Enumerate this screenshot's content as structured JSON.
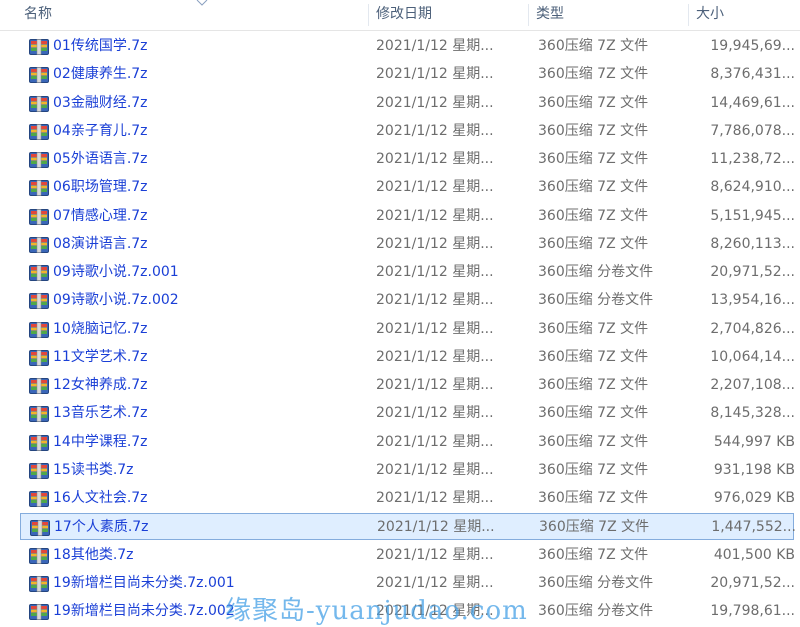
{
  "header": {
    "name": "名称",
    "date": "修改日期",
    "type": "类型",
    "size": "大小"
  },
  "files": [
    {
      "name": "01传统国学.7z",
      "date": "2021/1/12 星期...",
      "type": "360压缩 7Z 文件",
      "size": "19,945,69..."
    },
    {
      "name": "02健康养生.7z",
      "date": "2021/1/12 星期...",
      "type": "360压缩 7Z 文件",
      "size": "8,376,431..."
    },
    {
      "name": "03金融财经.7z",
      "date": "2021/1/12 星期...",
      "type": "360压缩 7Z 文件",
      "size": "14,469,61..."
    },
    {
      "name": "04亲子育儿.7z",
      "date": "2021/1/12 星期...",
      "type": "360压缩 7Z 文件",
      "size": "7,786,078..."
    },
    {
      "name": "05外语语言.7z",
      "date": "2021/1/12 星期...",
      "type": "360压缩 7Z 文件",
      "size": "11,238,72..."
    },
    {
      "name": "06职场管理.7z",
      "date": "2021/1/12 星期...",
      "type": "360压缩 7Z 文件",
      "size": "8,624,910..."
    },
    {
      "name": "07情感心理.7z",
      "date": "2021/1/12 星期...",
      "type": "360压缩 7Z 文件",
      "size": "5,151,945..."
    },
    {
      "name": "08演讲语言.7z",
      "date": "2021/1/12 星期...",
      "type": "360压缩 7Z 文件",
      "size": "8,260,113..."
    },
    {
      "name": "09诗歌小说.7z.001",
      "date": "2021/1/12 星期...",
      "type": "360压缩 分卷文件",
      "size": "20,971,52..."
    },
    {
      "name": "09诗歌小说.7z.002",
      "date": "2021/1/12 星期...",
      "type": "360压缩 分卷文件",
      "size": "13,954,16..."
    },
    {
      "name": "10烧脑记忆.7z",
      "date": "2021/1/12 星期...",
      "type": "360压缩 7Z 文件",
      "size": "2,704,826..."
    },
    {
      "name": "11文学艺术.7z",
      "date": "2021/1/12 星期...",
      "type": "360压缩 7Z 文件",
      "size": "10,064,14..."
    },
    {
      "name": "12女神养成.7z",
      "date": "2021/1/12 星期...",
      "type": "360压缩 7Z 文件",
      "size": "2,207,108..."
    },
    {
      "name": "13音乐艺术.7z",
      "date": "2021/1/12 星期...",
      "type": "360压缩 7Z 文件",
      "size": "8,145,328..."
    },
    {
      "name": "14中学课程.7z",
      "date": "2021/1/12 星期...",
      "type": "360压缩 7Z 文件",
      "size": "544,997 KB"
    },
    {
      "name": "15读书类.7z",
      "date": "2021/1/12 星期...",
      "type": "360压缩 7Z 文件",
      "size": "931,198 KB"
    },
    {
      "name": "16人文社会.7z",
      "date": "2021/1/12 星期...",
      "type": "360压缩 7Z 文件",
      "size": "976,029 KB"
    },
    {
      "name": "17个人素质.7z",
      "date": "2021/1/12 星期...",
      "type": "360压缩 7Z 文件",
      "size": "1,447,552...",
      "selected": true
    },
    {
      "name": "18其他类.7z",
      "date": "2021/1/12 星期...",
      "type": "360压缩 7Z 文件",
      "size": "401,500 KB"
    },
    {
      "name": "19新增栏目尚未分类.7z.001",
      "date": "2021/1/12 星期...",
      "type": "360压缩 分卷文件",
      "size": "20,971,52..."
    },
    {
      "name": "19新增栏目尚未分类.7z.002",
      "date": "2021/1/12 星期...",
      "type": "360压缩 分卷文件",
      "size": "19,798,61..."
    }
  ],
  "watermark": "缘聚岛-yuanjudao.com",
  "icon": "archive-file-icon",
  "colors": {
    "filename": "#1a3fd6",
    "selection_bg": "#dfeeff",
    "selection_border": "#84acdd",
    "watermark": "#46a0e6"
  }
}
